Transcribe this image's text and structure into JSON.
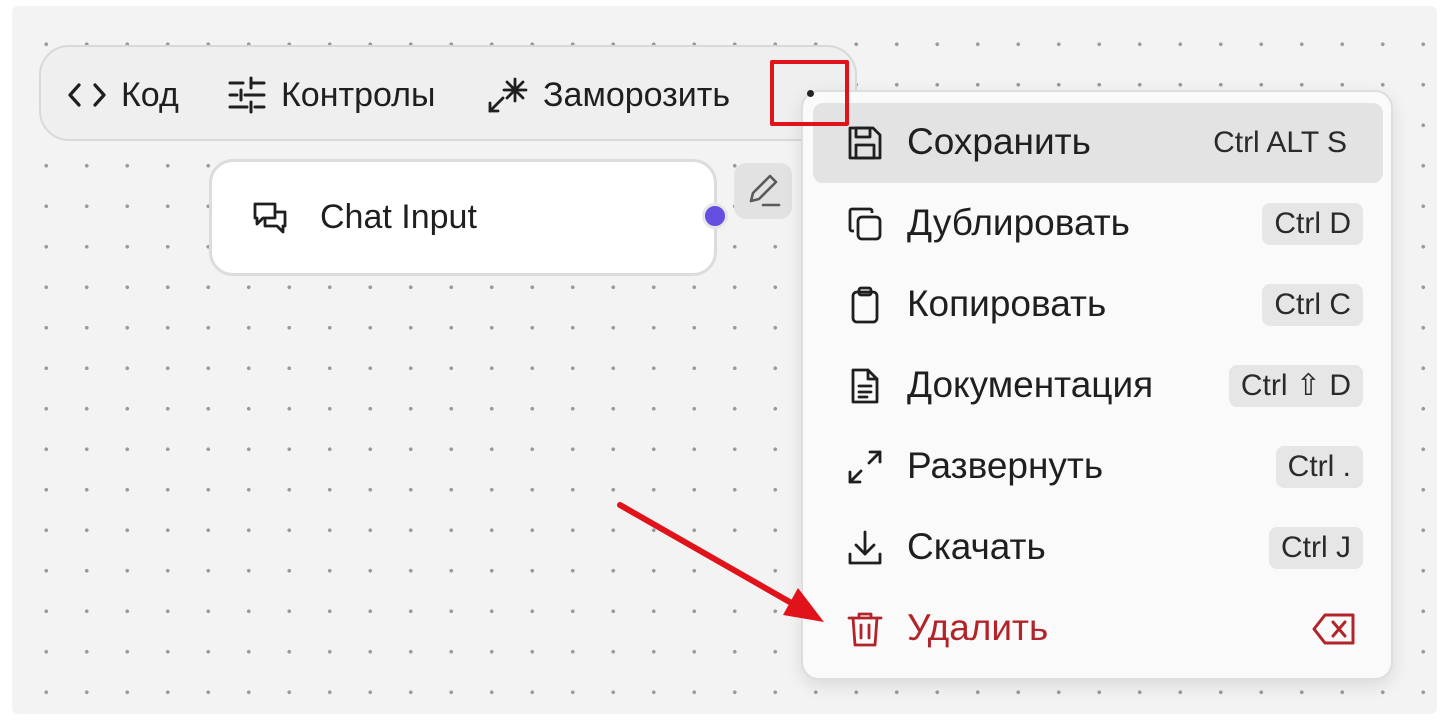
{
  "toolbar": {
    "code_label": "Код",
    "controls_label": "Контролы",
    "freeze_label": "Заморозить"
  },
  "node": {
    "title": "Chat Input",
    "handle_color": "#6450e0"
  },
  "menu": {
    "items": [
      {
        "label": "Сохранить",
        "shortcut": "Ctrl ALT S",
        "icon": "save-icon"
      },
      {
        "label": "Дублировать",
        "shortcut": "Ctrl D",
        "icon": "duplicate-icon"
      },
      {
        "label": "Копировать",
        "shortcut": "Ctrl C",
        "icon": "clipboard-icon"
      },
      {
        "label": "Документация",
        "shortcut": "Ctrl ⇧ D",
        "icon": "document-icon"
      },
      {
        "label": "Развернуть",
        "shortcut": "Ctrl .",
        "icon": "expand-icon"
      },
      {
        "label": "Скачать",
        "shortcut": "Ctrl J",
        "icon": "download-icon"
      },
      {
        "label": "Удалить",
        "shortcut": "",
        "icon": "trash-icon"
      }
    ]
  },
  "colors": {
    "accent": "#6450e0",
    "danger": "#b1242a",
    "annotation_red": "#e0121a"
  }
}
